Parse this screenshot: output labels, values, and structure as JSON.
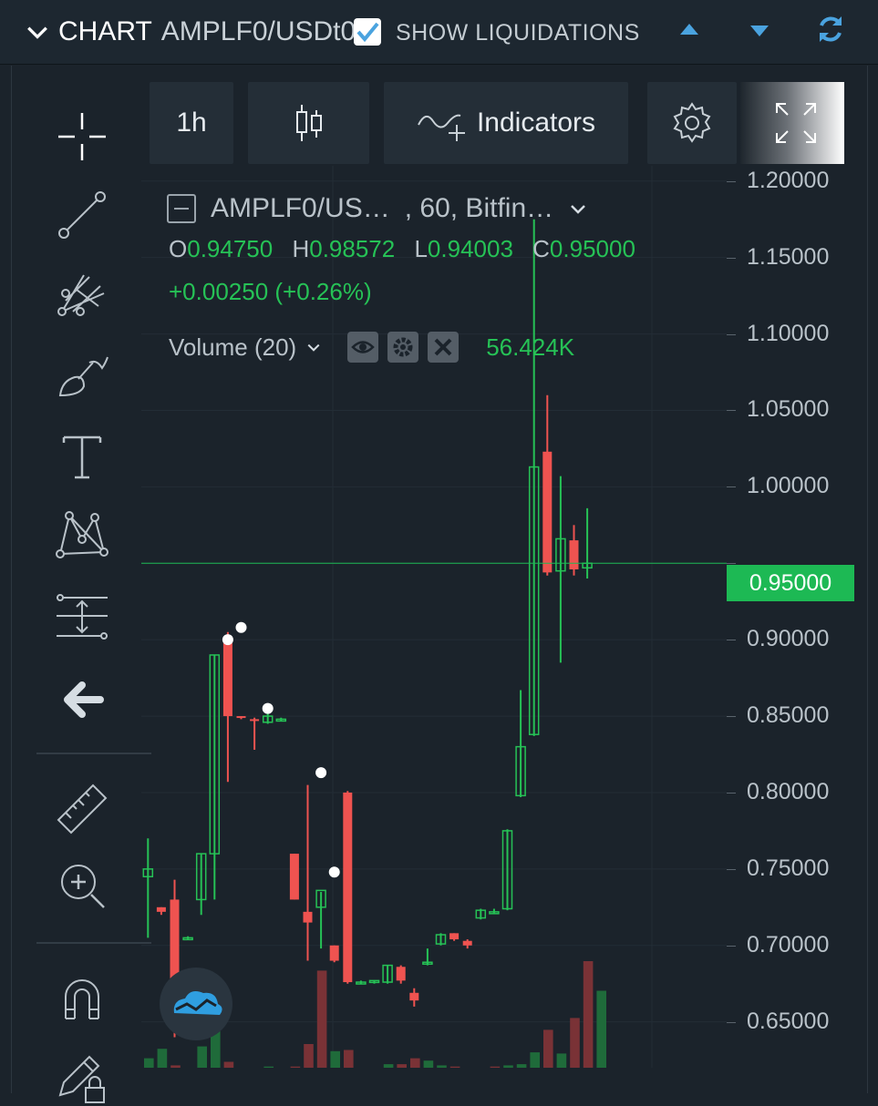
{
  "header": {
    "title": "CHART",
    "pair": "AMPLF0/USDt0",
    "show_liquidations_label": "SHOW LIQUIDATIONS",
    "show_liquidations_checked": true,
    "accent": "#4aa3df"
  },
  "toolbar": {
    "interval_label": "1h",
    "indicators_label": "Indicators",
    "icons": [
      "candles-icon",
      "indicators-icon",
      "settings-gear-icon",
      "fullscreen-icon"
    ]
  },
  "left_tools": [
    "crosshair-icon",
    "trend-line-icon",
    "pitchfork-icon",
    "brush-icon",
    "text-icon",
    "pattern-icon",
    "measure-arrows-icon",
    "back-arrow-icon",
    "ruler-icon",
    "zoom-in-icon",
    "magnet-icon",
    "pencil-lock-icon"
  ],
  "legend": {
    "symbol": "AMPLF0/US…",
    "interval_exchange": ", 60, Bitfin…",
    "open_label": "O",
    "open": "0.94750",
    "high_label": "H",
    "high": "0.98572",
    "low_label": "L",
    "low": "0.94003",
    "close_label": "C",
    "close": "0.95000",
    "change": "+0.00250 (+0.26%)",
    "volume_label": "Volume (20)",
    "volume_value": "56.424K"
  },
  "colors": {
    "up": "#26c256",
    "down": "#ef5350",
    "bg": "#1b232b",
    "price_tag": "#1db954"
  },
  "chart_data": {
    "type": "candlestick",
    "price_axis_ticks": [
      "1.20000",
      "1.15000",
      "1.10000",
      "1.05000",
      "1.00000",
      "0.95000",
      "0.90000",
      "0.85000",
      "0.80000",
      "0.75000",
      "0.70000",
      "0.65000"
    ],
    "ylim": [
      0.62,
      1.21
    ],
    "last_price": "0.95000",
    "candles": [
      {
        "o": 0.745,
        "h": 0.77,
        "l": 0.705,
        "c": 0.75
      },
      {
        "o": 0.725,
        "h": 0.725,
        "l": 0.72,
        "c": 0.722
      },
      {
        "o": 0.73,
        "h": 0.743,
        "l": 0.64,
        "c": 0.66
      },
      {
        "o": 0.705,
        "h": 0.706,
        "l": 0.704,
        "c": 0.705
      },
      {
        "o": 0.73,
        "h": 0.76,
        "l": 0.72,
        "c": 0.76
      },
      {
        "o": 0.76,
        "h": 0.89,
        "l": 0.73,
        "c": 0.89
      },
      {
        "o": 0.9,
        "h": 0.905,
        "l": 0.807,
        "c": 0.85
      },
      {
        "o": 0.85,
        "h": 0.85,
        "l": 0.848,
        "c": 0.849
      },
      {
        "o": 0.848,
        "h": 0.849,
        "l": 0.828,
        "c": 0.847
      },
      {
        "o": 0.846,
        "h": 0.853,
        "l": 0.845,
        "c": 0.85
      },
      {
        "o": 0.848,
        "h": 0.849,
        "l": 0.847,
        "c": 0.848
      },
      {
        "o": 0.76,
        "h": 0.76,
        "l": 0.73,
        "c": 0.73
      },
      {
        "o": 0.722,
        "h": 0.805,
        "l": 0.69,
        "c": 0.715
      },
      {
        "o": 0.725,
        "h": 0.735,
        "l": 0.698,
        "c": 0.736
      },
      {
        "o": 0.7,
        "h": 0.7,
        "l": 0.689,
        "c": 0.69
      },
      {
        "o": 0.8,
        "h": 0.801,
        "l": 0.675,
        "c": 0.676
      },
      {
        "o": 0.676,
        "h": 0.677,
        "l": 0.675,
        "c": 0.676
      },
      {
        "o": 0.676,
        "h": 0.677,
        "l": 0.675,
        "c": 0.677
      },
      {
        "o": 0.676,
        "h": 0.687,
        "l": 0.675,
        "c": 0.687
      },
      {
        "o": 0.686,
        "h": 0.687,
        "l": 0.675,
        "c": 0.677
      },
      {
        "o": 0.669,
        "h": 0.672,
        "l": 0.66,
        "c": 0.664
      },
      {
        "o": 0.688,
        "h": 0.698,
        "l": 0.687,
        "c": 0.689
      },
      {
        "o": 0.701,
        "h": 0.708,
        "l": 0.7,
        "c": 0.707
      },
      {
        "o": 0.708,
        "h": 0.708,
        "l": 0.703,
        "c": 0.704
      },
      {
        "o": 0.703,
        "h": 0.704,
        "l": 0.698,
        "c": 0.7
      },
      {
        "o": 0.718,
        "h": 0.724,
        "l": 0.717,
        "c": 0.723
      },
      {
        "o": 0.722,
        "h": 0.724,
        "l": 0.721,
        "c": 0.722
      },
      {
        "o": 0.724,
        "h": 0.776,
        "l": 0.723,
        "c": 0.775
      },
      {
        "o": 0.798,
        "h": 0.867,
        "l": 0.797,
        "c": 0.83
      },
      {
        "o": 0.838,
        "h": 1.175,
        "l": 0.837,
        "c": 1.013
      },
      {
        "o": 1.023,
        "h": 1.06,
        "l": 0.942,
        "c": 0.944
      },
      {
        "o": 0.945,
        "h": 1.007,
        "l": 0.885,
        "c": 0.966
      },
      {
        "o": 0.965,
        "h": 0.975,
        "l": 0.942,
        "c": 0.946
      },
      {
        "o": 0.947,
        "h": 0.986,
        "l": 0.94,
        "c": 0.95
      }
    ],
    "volumes": [
      0.08,
      0.16,
      0.02,
      0.0,
      0.18,
      0.5,
      0.05,
      0.0,
      0.0,
      0.01,
      0.0,
      0.01,
      0.2,
      0.82,
      0.14,
      0.15,
      0.0,
      0.0,
      0.03,
      0.03,
      0.08,
      0.06,
      0.02,
      0.01,
      0.0,
      0.0,
      0.01,
      0.02,
      0.03,
      0.13,
      0.32,
      0.12,
      0.42,
      0.9,
      0.65
    ],
    "volume_up": [
      true,
      true,
      false,
      true,
      true,
      true,
      false,
      true,
      false,
      true,
      true,
      false,
      false,
      false,
      true,
      false,
      true,
      true,
      true,
      false,
      false,
      true,
      true,
      false,
      false,
      true,
      false,
      true,
      true,
      true,
      false,
      true,
      false,
      false,
      true
    ],
    "liquidation_markers": [
      {
        "x": 6,
        "y": 0.9
      },
      {
        "x": 7,
        "y": 0.908
      },
      {
        "x": 9,
        "y": 0.855
      },
      {
        "x": 13,
        "y": 0.813
      },
      {
        "x": 14,
        "y": 0.748
      }
    ]
  }
}
